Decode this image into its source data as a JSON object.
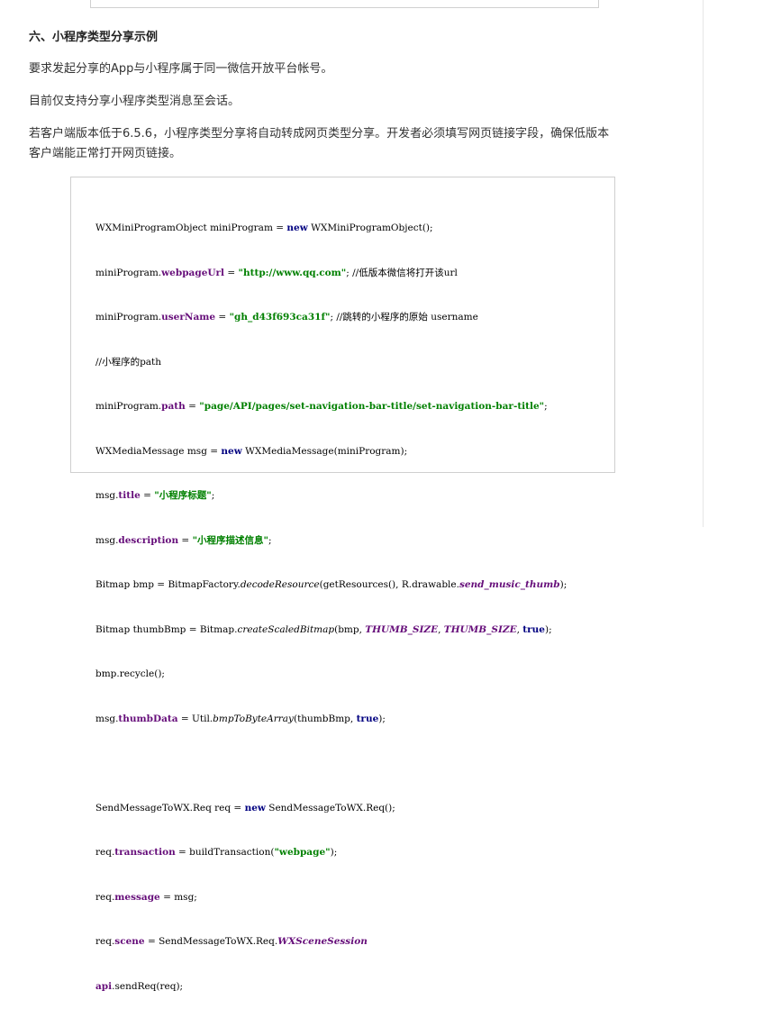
{
  "section": {
    "title": "六、小程序类型分享示例"
  },
  "paragraphs": {
    "p1": "要求发起分享的App与小程序属于同一微信开放平台帐号。",
    "p2": "目前仅支持分享小程序类型消息至会话。",
    "p3_line1": "若客户端版本低于6.5.6，小程序类型分享将自动转成网页类型分享。开发者必须填写网页链接字段，确保低版本",
    "p3_line2": "客户端能正常打开网页链接。"
  },
  "code": {
    "l1_a": "WXMiniProgramObject miniProgram = ",
    "l1_kw": "new",
    "l1_b": " WXMiniProgramObject();",
    "l2_a": "miniProgram.",
    "l2_fld": "webpageUrl",
    "l2_b": " = ",
    "l2_str": "\"http://www.qq.com\"",
    "l2_c": "; //低版本微信将打开该url",
    "l3_a": "miniProgram.",
    "l3_fld": "userName",
    "l3_b": " = ",
    "l3_str": "\"gh_d43f693ca31f\"",
    "l3_c": "; //跳转的小程序的原始 username",
    "l4": "//小程序的path",
    "l5_a": "miniProgram.",
    "l5_fld": "path",
    "l5_b": " = ",
    "l5_str": "\"page/API/pages/set-navigation-bar-title/set-navigation-bar-title\"",
    "l5_c": ";",
    "l6_a": "WXMediaMessage msg = ",
    "l6_kw": "new",
    "l6_b": " WXMediaMessage(miniProgram);",
    "l7_a": "msg.",
    "l7_fld": "title",
    "l7_b": " = ",
    "l7_str": "\"小程序标题\"",
    "l7_c": ";",
    "l8_a": "msg.",
    "l8_fld": "description",
    "l8_b": " = ",
    "l8_str": "\"小程序描述信息\"",
    "l8_c": ";",
    "l9_a": "Bitmap bmp = BitmapFactory.",
    "l9_it": "decodeResource",
    "l9_b": "(getResources(), R.drawable.",
    "l9_const": "send_music_thumb",
    "l9_c": ");",
    "l10_a": "Bitmap thumbBmp = Bitmap.",
    "l10_it": "createScaledBitmap",
    "l10_b": "(bmp, ",
    "l10_const1": "THUMB_SIZE",
    "l10_c": ", ",
    "l10_const2": "THUMB_SIZE",
    "l10_d": ", ",
    "l10_kw": "true",
    "l10_e": ");",
    "l11": "bmp.recycle();",
    "l12_a": "msg.",
    "l12_fld": "thumbData",
    "l12_b": " = Util.",
    "l12_it": "bmpToByteArray",
    "l12_c": "(thumbBmp, ",
    "l12_kw": "true",
    "l12_d": ");",
    "l14_a": "SendMessageToWX.Req req = ",
    "l14_kw": "new",
    "l14_b": " SendMessageToWX.Req();",
    "l15_a": "req.",
    "l15_fld": "transaction",
    "l15_b": " = buildTransaction(",
    "l15_str": "\"webpage\"",
    "l15_c": ");",
    "l16_a": "req.",
    "l16_fld": "message",
    "l16_b": " = msg;",
    "l17_a": "req.",
    "l17_fld": "scene",
    "l17_b": " = SendMessageToWX.Req.",
    "l17_const": "WXSceneSession",
    "l18_fld": "api",
    "l18_b": ".sendReq(req);"
  }
}
